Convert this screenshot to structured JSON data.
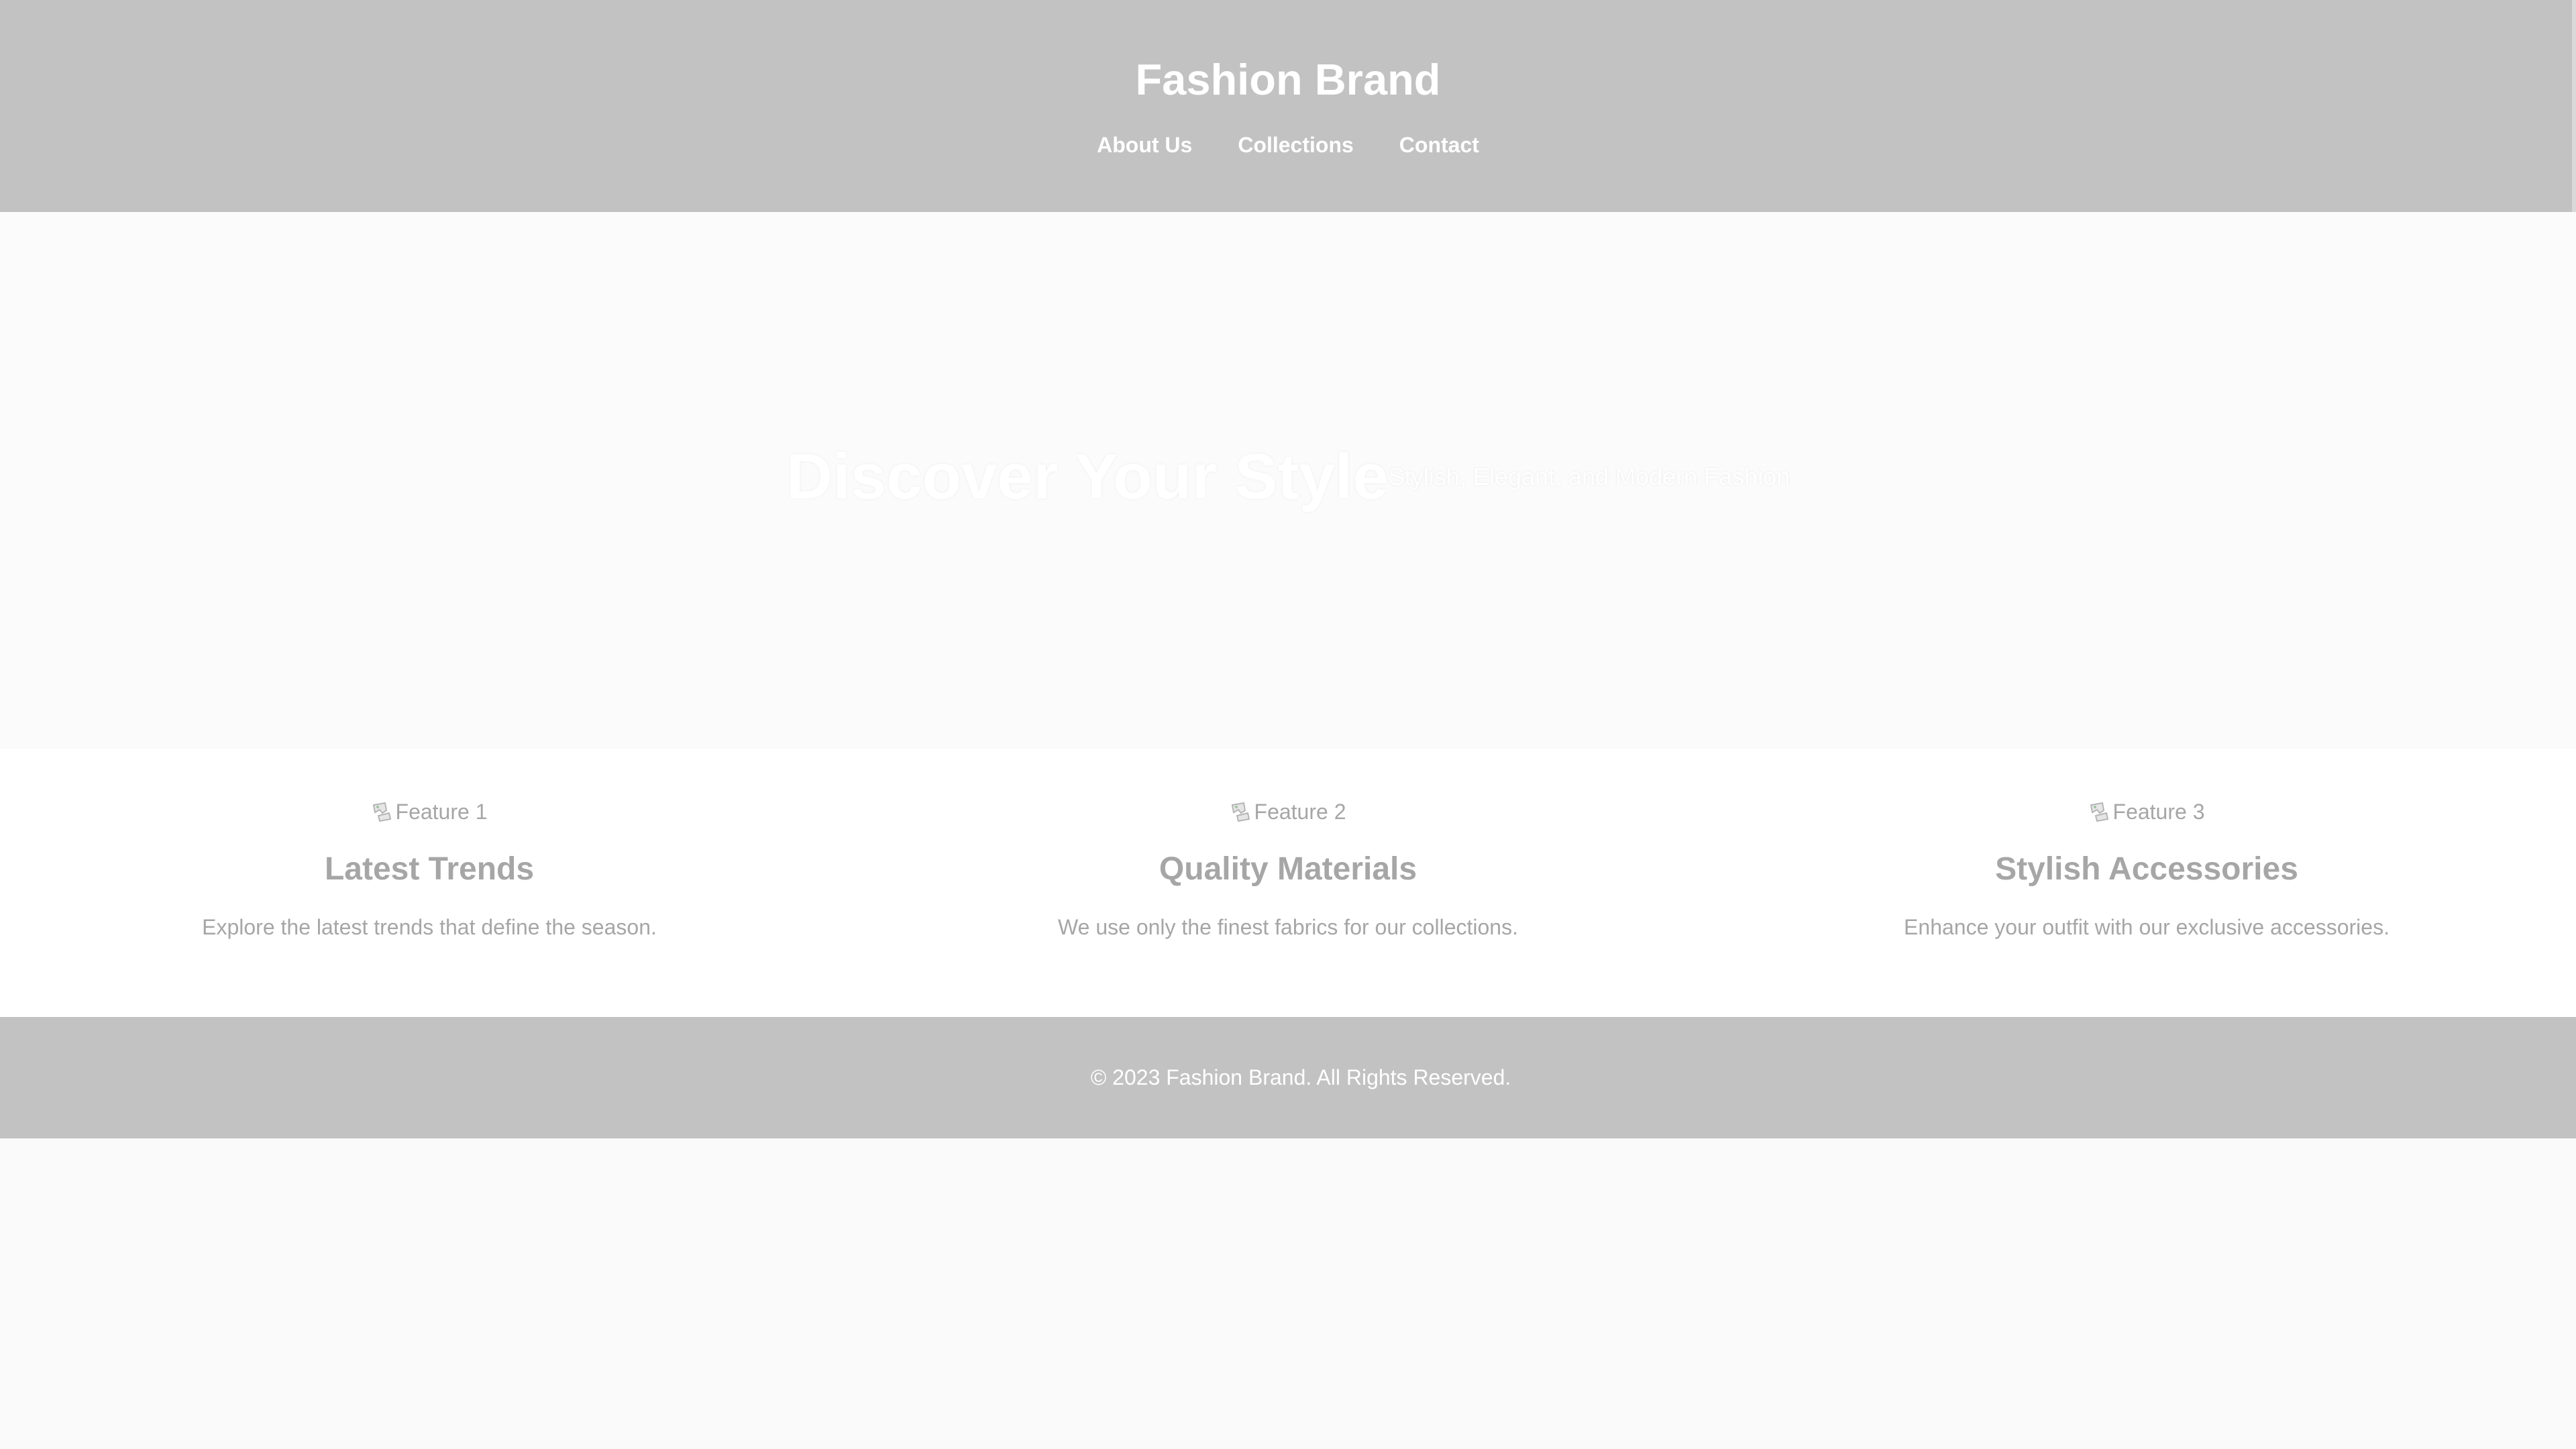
{
  "header": {
    "brand": "Fashion Brand",
    "nav": [
      {
        "label": "About Us"
      },
      {
        "label": "Collections"
      },
      {
        "label": "Contact"
      }
    ]
  },
  "hero": {
    "title": "Discover Your Style",
    "subtitle": "Stylish, Elegant, and Modern Fashion"
  },
  "features": [
    {
      "image_alt": "Feature 1",
      "title": "Latest Trends",
      "text": "Explore the latest trends that define the season."
    },
    {
      "image_alt": "Feature 2",
      "title": "Quality Materials",
      "text": "We use only the finest fabrics for our collections."
    },
    {
      "image_alt": "Feature 3",
      "title": "Stylish Accessories",
      "text": "Enhance your outfit with our exclusive accessories."
    }
  ],
  "footer": {
    "copyright": "© 2023 Fashion Brand. All Rights Reserved."
  },
  "colors": {
    "header_bg": "#c2c2c2",
    "footer_bg": "#c2c2c2",
    "hero_bg": "#fbfbfb",
    "text_muted": "#a6a6a6",
    "text_light": "#ffffff"
  },
  "icons": {
    "broken_image": "broken-image-icon"
  }
}
